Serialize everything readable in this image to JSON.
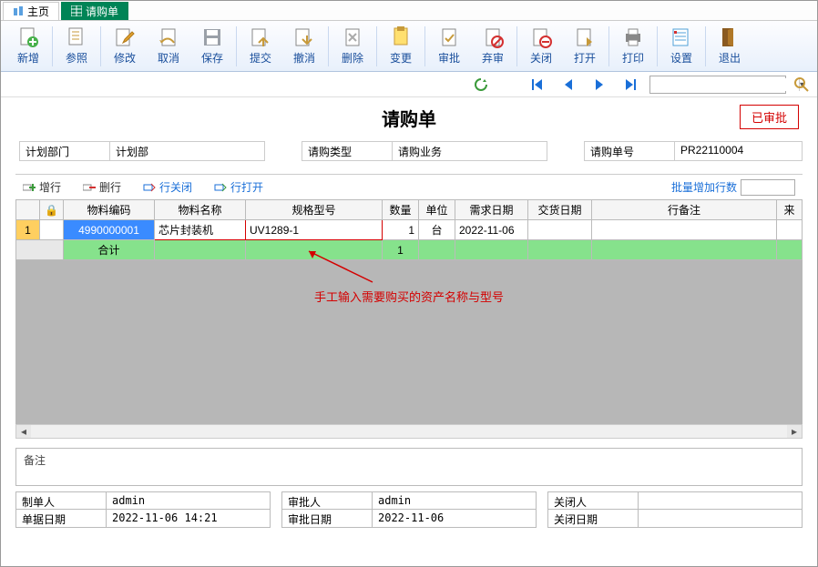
{
  "tabs": {
    "home": "主页",
    "current": "请购单"
  },
  "toolbar": {
    "new": "新增",
    "ref": "参照",
    "edit": "修改",
    "cancel": "取消",
    "save": "保存",
    "submit": "提交",
    "revoke": "撤消",
    "delete": "删除",
    "change": "变更",
    "approve": "审批",
    "reject": "弃审",
    "close": "关闭",
    "open": "打开",
    "print": "打印",
    "settings": "设置",
    "exit": "退出"
  },
  "page": {
    "title": "请购单",
    "stamp": "已审批"
  },
  "header": {
    "dept_label": "计划部门",
    "dept_value": "计划部",
    "type_label": "请购类型",
    "type_value": "请购业务",
    "no_label": "请购单号",
    "no_value": "PR22110004"
  },
  "gridtoolbar": {
    "addrow": "增行",
    "delrow": "删行",
    "rowclose": "行关闭",
    "rowopen": "行打开",
    "batch_label": "批量增加行数"
  },
  "grid": {
    "cols": {
      "code": "物料编码",
      "name": "物料名称",
      "spec": "规格型号",
      "qty": "数量",
      "unit": "单位",
      "need": "需求日期",
      "ship": "交货日期",
      "remark": "行备注",
      "more": "来"
    },
    "row": {
      "idx": "1",
      "code": "4990000001",
      "name": "芯片封装机",
      "spec": "UV1289-1",
      "qty": "1",
      "unit": "台",
      "need": "2022-11-06",
      "ship": "",
      "remark": ""
    },
    "sum": {
      "label": "合计",
      "qty": "1"
    },
    "annotation": "手工输入需要购买的资产名称与型号"
  },
  "remark_label": "备注",
  "footer": {
    "maker_label": "制单人",
    "maker": "admin",
    "docdate_label": "单据日期",
    "docdate": "2022-11-06 14:21",
    "approver_label": "审批人",
    "approver": "admin",
    "approvedate_label": "审批日期",
    "approvedate": "2022-11-06",
    "closer_label": "关闭人",
    "closer": "",
    "closedate_label": "关闭日期",
    "closedate": ""
  }
}
